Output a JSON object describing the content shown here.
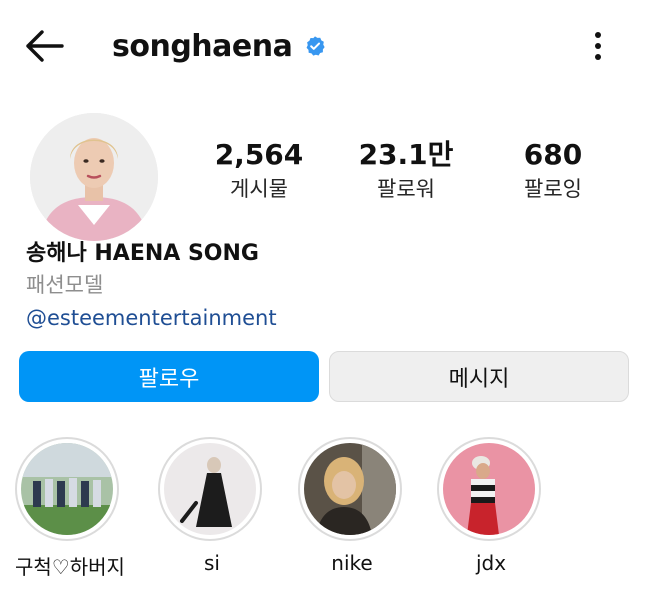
{
  "header": {
    "back_icon": "arrow-left-icon",
    "username": "songhaena",
    "verified_icon": "verified-badge-icon",
    "more_icon": "more-vertical-icon"
  },
  "stats": [
    {
      "value": "2,564",
      "label": "게시물"
    },
    {
      "value": "23.1만",
      "label": "팔로워"
    },
    {
      "value": "680",
      "label": "팔로잉"
    }
  ],
  "bio": {
    "name": "송해나 HAENA SONG",
    "category": "패션모델",
    "link": "@esteementertainment"
  },
  "actions": {
    "follow_label": "팔로우",
    "message_label": "메시지"
  },
  "highlights": [
    {
      "label": "구척♡하버지"
    },
    {
      "label": "si"
    },
    {
      "label": "nike"
    },
    {
      "label": "jdx"
    }
  ],
  "colors": {
    "primary_blue": "#0095f6",
    "link_blue": "#1f4e94",
    "verified_blue": "#3897f0",
    "muted_text": "#8e8e8e",
    "secondary_button": "#efefef"
  }
}
